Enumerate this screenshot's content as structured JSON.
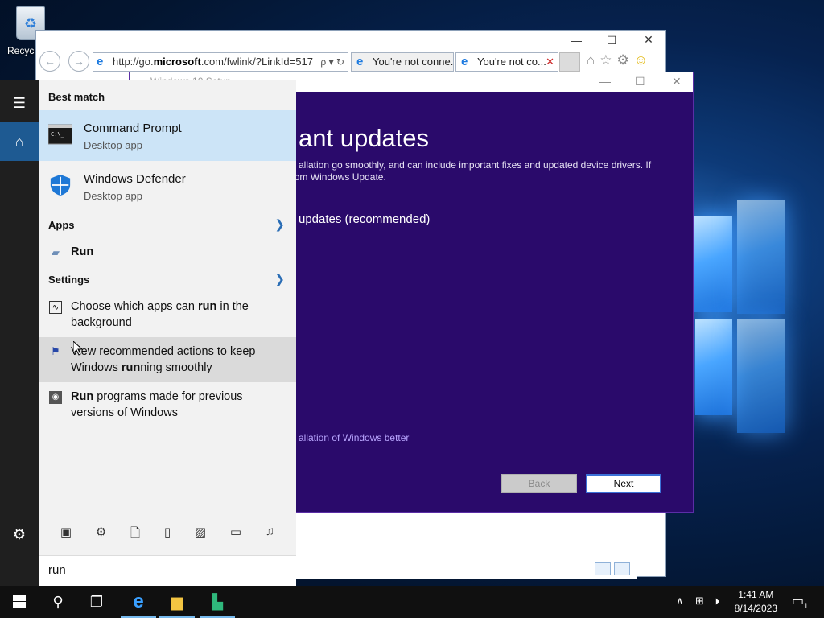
{
  "desktop": {
    "recycle_label": "Recycl"
  },
  "ie": {
    "address": "http://go.",
    "address_bold": "microsoft",
    "address_rest": ".com/fwlink/?LinkId=517",
    "tabs": [
      {
        "label": "You're not conne..."
      },
      {
        "label": "You're not co..."
      }
    ],
    "back_icon": "back-arrow-icon",
    "forward_icon": "forward-arrow-icon",
    "accent": "#1e7be0"
  },
  "setup": {
    "title": "Windows 10 Setup",
    "heading": "ant updates",
    "desc": "allation go smoothly, and can include important fixes and updated device drivers. If now, you will get them later from Windows Update.",
    "option": "updates (recommended)",
    "link": "allation of Windows better",
    "back_label": "Back",
    "next_label": "Next",
    "bg_color": "#2a0a6b"
  },
  "start": {
    "best_match_label": "Best match",
    "best": [
      {
        "title": "Command Prompt",
        "subtitle": "Desktop app"
      },
      {
        "title": "Windows Defender",
        "subtitle": "Desktop app"
      }
    ],
    "apps_label": "Apps",
    "run_label": "Run",
    "settings_label": "Settings",
    "settings_items": [
      {
        "text_before": "Choose which apps can ",
        "bold": "run",
        "text_after": " in the background"
      },
      {
        "text_before": "View recommended actions to keep Windows ",
        "bold": "run",
        "text_after": "ning smoothly"
      },
      {
        "text_before": "",
        "bold": "Run",
        "text_after": " programs made for previous versions of Windows"
      }
    ],
    "search_text": "run",
    "filter_icons": [
      "apps-icon",
      "settings-icon",
      "document-icon",
      "phone-icon",
      "photo-icon",
      "video-icon",
      "music-icon"
    ]
  },
  "taskbar": {
    "time": "1:41 AM",
    "date": "8/14/2023",
    "notification_count": "1"
  }
}
